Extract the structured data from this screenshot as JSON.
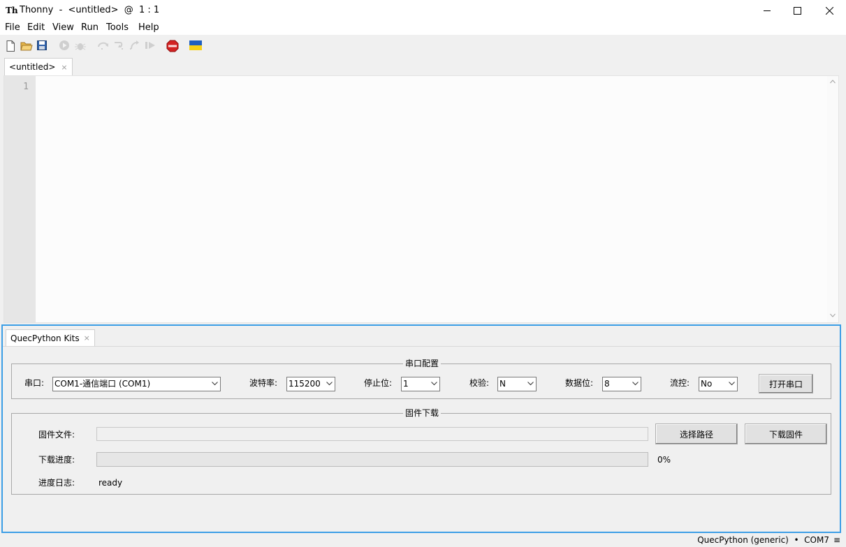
{
  "window": {
    "title": "Thonny  -  <untitled>  @  1 : 1",
    "app_icon": "Th"
  },
  "menu": [
    "File",
    "Edit",
    "View",
    "Run",
    "Tools",
    "Help"
  ],
  "toolbar": {
    "icons": [
      "new-file-icon",
      "open-file-icon",
      "save-icon",
      "run-icon",
      "debug-icon",
      "step-over-icon",
      "step-into-icon",
      "step-out-icon",
      "resume-icon",
      "stop-icon",
      "ukraine-flag-icon"
    ]
  },
  "editor": {
    "tab_label": "<untitled>",
    "tab_close": "×",
    "line_numbers": [
      "1"
    ]
  },
  "panel": {
    "tab_label": "QuecPython Kits",
    "tab_close": "×",
    "serial": {
      "group_title": "串口配置",
      "port_label": "串口:",
      "port_value": "COM1-通信端口 (COM1)",
      "baud_label": "波特率:",
      "baud_value": "115200",
      "stopbits_label": "停止位:",
      "stopbits_value": "1",
      "parity_label": "校验:",
      "parity_value": "N",
      "databits_label": "数据位:",
      "databits_value": "8",
      "flow_label": "流控:",
      "flow_value": "No",
      "open_button": "打开串口"
    },
    "firmware": {
      "group_title": "固件下载",
      "file_label": "固件文件:",
      "file_value": "",
      "choose_path_button": "选择路径",
      "download_button": "下载固件",
      "progress_label": "下载进度:",
      "progress_value": 0,
      "progress_text": "0%",
      "log_label": "进度日志:",
      "log_value": "ready"
    }
  },
  "statusbar": {
    "text": "QuecPython (generic)  •  COM7",
    "menu_glyph": "≡"
  },
  "colors": {
    "panel_border": "#3b9ee6",
    "progress_fill": "#06b025"
  }
}
